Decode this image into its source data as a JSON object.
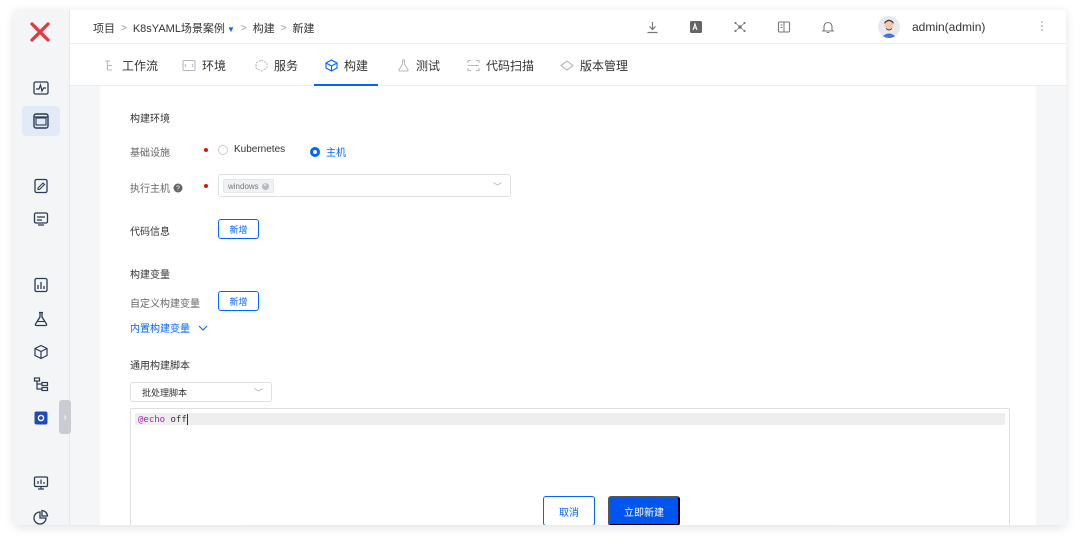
{
  "breadcrumb": {
    "items": [
      "项目",
      "K8sYAML场景案例",
      "构建",
      "新建"
    ],
    "separator": ">"
  },
  "user": {
    "name": "admin(admin)"
  },
  "tabs": [
    {
      "label": "工作流",
      "icon": "workflow-icon"
    },
    {
      "label": "环境",
      "icon": "environment-icon"
    },
    {
      "label": "服务",
      "icon": "service-icon"
    },
    {
      "label": "构建",
      "icon": "build-icon",
      "active": true
    },
    {
      "label": "测试",
      "icon": "test-icon"
    },
    {
      "label": "代码扫描",
      "icon": "scan-icon"
    },
    {
      "label": "版本管理",
      "icon": "version-icon"
    }
  ],
  "form": {
    "build_env_title": "构建环境",
    "infra_label": "基础设施",
    "infra_options": [
      "Kubernetes",
      "主机"
    ],
    "infra_selected": "主机",
    "host_label": "执行主机",
    "host_tag": "windows",
    "code_info_title": "代码信息",
    "code_info_add": "新增",
    "build_vars_title": "构建变量",
    "custom_vars_label": "自定义构建变量",
    "custom_vars_add": "新增",
    "builtin_vars_link": "内置构建变量",
    "script_title": "通用构建脚本",
    "script_type": "批处理脚本",
    "script_code_kw": "@echo",
    "script_code_rest": " off"
  },
  "actions": {
    "cancel": "取消",
    "create": "立即新建"
  },
  "colors": {
    "accent": "#0066ff",
    "logo": "#e8343d",
    "required": "#dd1111"
  }
}
